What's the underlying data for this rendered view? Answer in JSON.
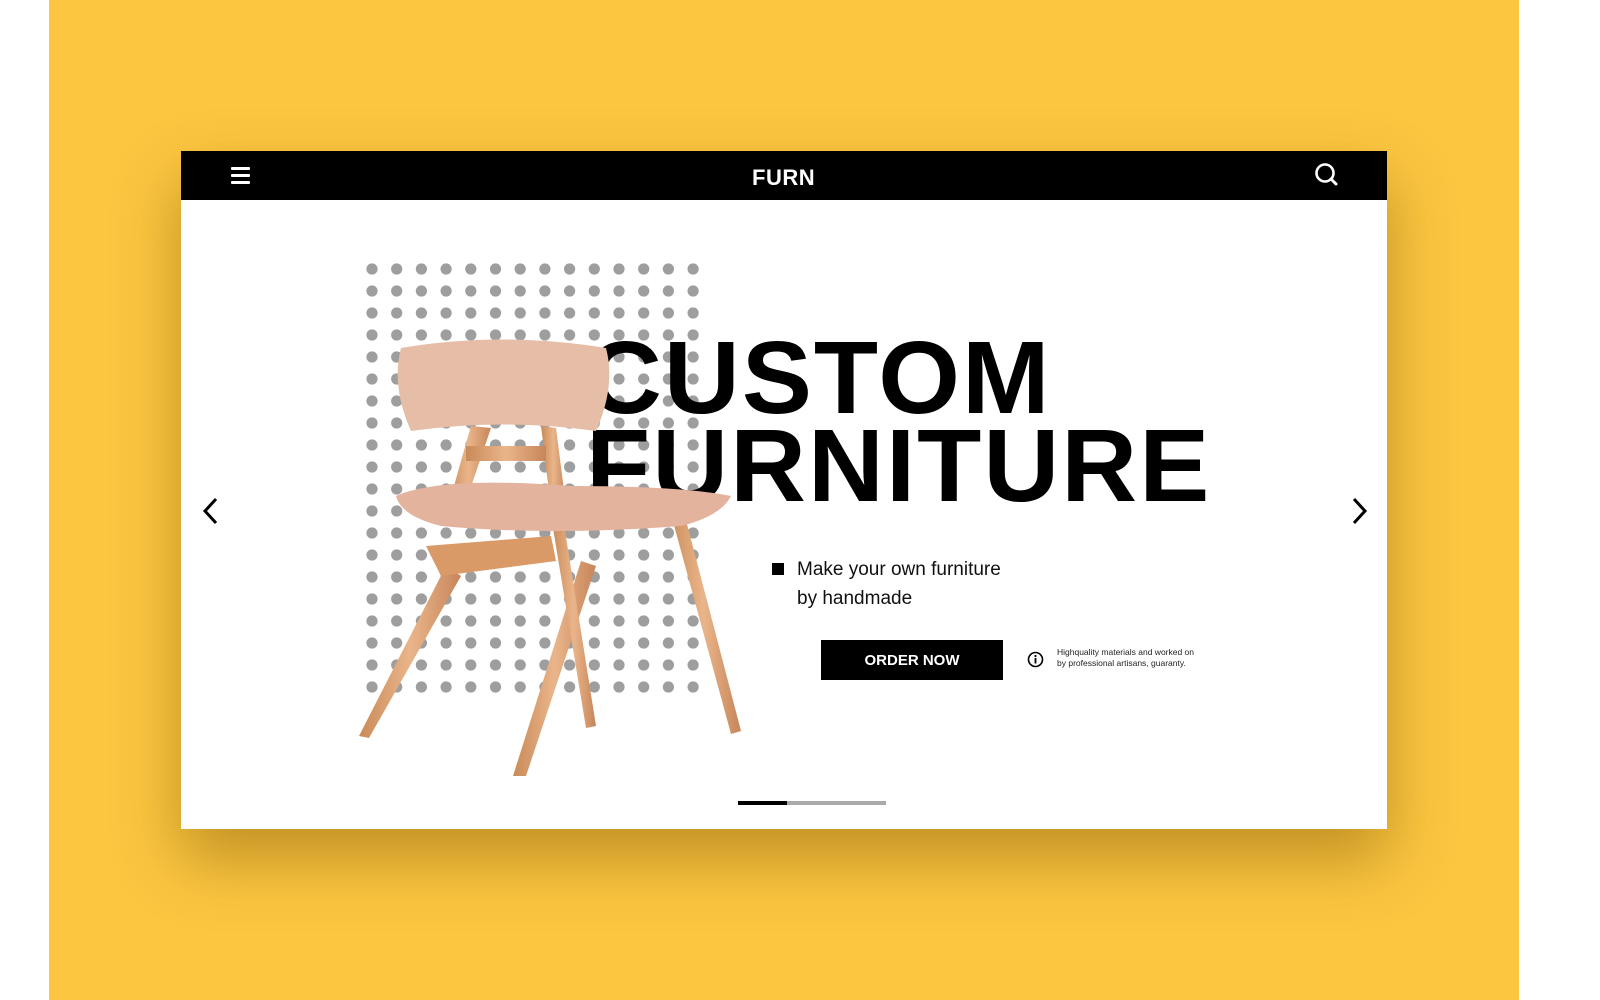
{
  "brand": {
    "logo": "FURN"
  },
  "hero": {
    "line1": "CUSTOM",
    "line2": "FURNITURE",
    "tagline_1": "Make your own furniture",
    "tagline_2": "by handmade",
    "cta": "ORDER NOW",
    "note_1": "Highquality materials and worked on",
    "note_2": "by professional artisans, guaranty."
  },
  "slider": {
    "current": 1,
    "total": 3,
    "progress_fraction": 0.33
  },
  "icons": [
    "menu-icon",
    "search-icon",
    "chevron-left-icon",
    "chevron-right-icon",
    "info-icon"
  ],
  "colors": {
    "background": "#fcc640",
    "nav": "#000000",
    "dots": "#9e9e9e"
  }
}
